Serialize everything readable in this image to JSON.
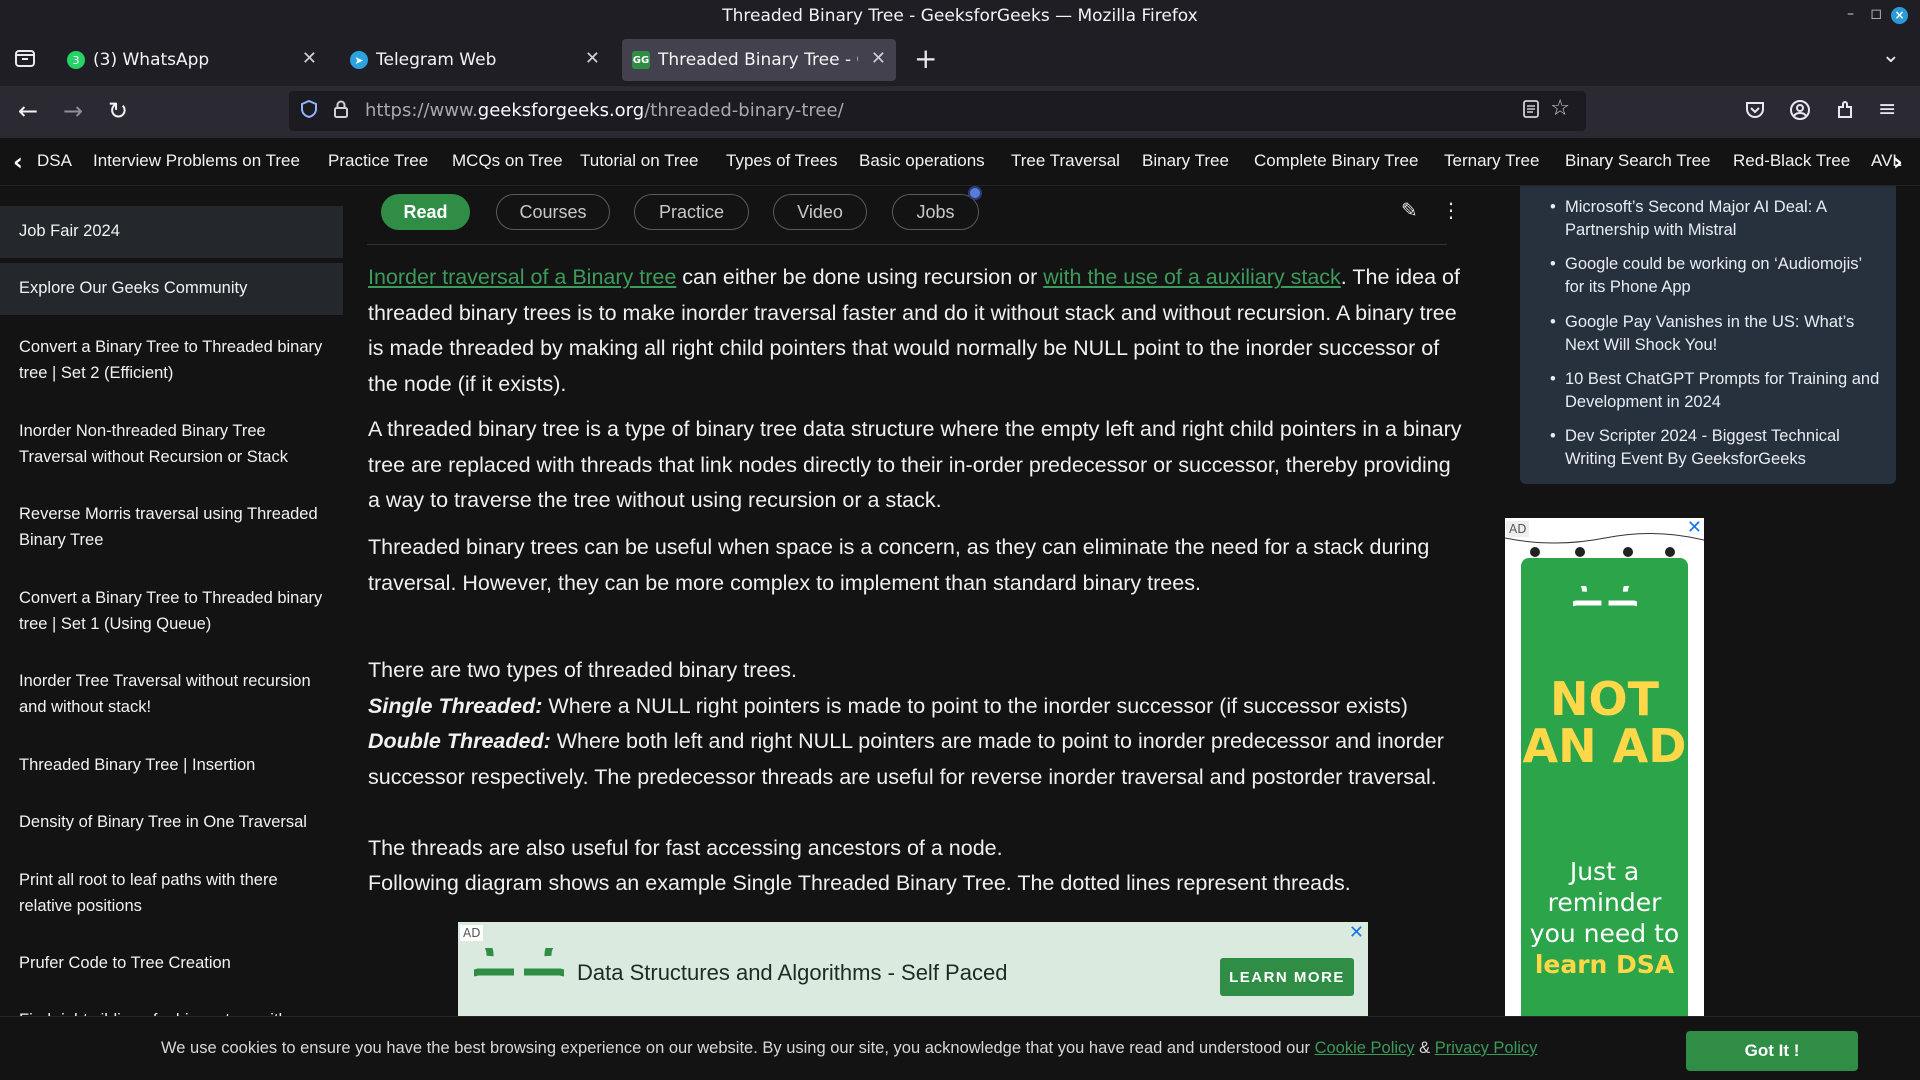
{
  "window": {
    "title": "Threaded Binary Tree - GeeksforGeeks — Mozilla Firefox",
    "minimize": "–",
    "maximize": "◻",
    "close": "×"
  },
  "tabs": [
    {
      "label": "(3) WhatsApp",
      "icon": "whatsapp-icon",
      "badge": "3",
      "active": false
    },
    {
      "label": "Telegram Web",
      "icon": "telegram-icon",
      "active": false
    },
    {
      "label": "Threaded Binary Tree - Gee",
      "icon": "gfg-icon",
      "active": true
    }
  ],
  "tab_controls": {
    "new_tab": "+",
    "list_all": "⌄",
    "close": "✕"
  },
  "navbar": {
    "back": "←",
    "forward": "→",
    "reload": "↻",
    "url_prefix": "https://www.",
    "url_host": "geeksforgeeks.org",
    "url_path": "/threaded-binary-tree/"
  },
  "bookmarks": [
    "DSA",
    "Interview Problems on Tree",
    "Practice Tree",
    "MCQs on Tree",
    "Tutorial on Tree",
    "Types of Trees",
    "Basic operations",
    "Tree Traversal",
    "Binary Tree",
    "Complete Binary Tree",
    "Ternary Tree",
    "Binary Search Tree",
    "Red-Black Tree",
    "AVL"
  ],
  "sidebar": {
    "items": [
      "Job Fair 2024",
      "Explore Our Geeks Community",
      "Convert a Binary Tree to Threaded binary tree | Set 2 (Efficient)",
      "Inorder Non-threaded Binary Tree Traversal without Recursion or Stack",
      "Reverse Morris traversal using Threaded Binary Tree",
      "Convert a Binary Tree to Threaded binary tree | Set 1 (Using Queue)",
      "Inorder Tree Traversal without recursion and without stack!",
      "Threaded Binary Tree | Insertion",
      "Density of Binary Tree in One Traversal",
      "Print all root to leaf paths with there relative positions",
      "Prufer Code to Tree Creation",
      "Find right sibling of a binary tree with parent pointers"
    ]
  },
  "article_tabs": [
    "Read",
    "Courses",
    "Practice",
    "Video",
    "Jobs"
  ],
  "article": {
    "p1_link1": "Inorder traversal of a Binary tree",
    "p1_mid": " can either be done using recursion or ",
    "p1_link2": "with the use of a auxiliary stack",
    "p1_rest": ". The idea of threaded binary trees is to make inorder traversal faster and do it without stack and without recursion. A binary tree is made threaded by making all right child pointers that would normally be NULL point to the inorder successor of the node (if it exists).",
    "p2": "A threaded binary tree is a type of binary tree data structure where the empty left and right child pointers in a binary tree are replaced with threads that link nodes directly to their in-order predecessor or successor, thereby providing a way to traverse the tree without using recursion or a stack.",
    "p3": "Threaded binary trees can be useful when space is a concern, as they can eliminate the need for a stack during traversal. However, they can be more complex to implement than standard binary trees.",
    "types_intro": "There are two types of threaded binary trees.",
    "single_label": "Single Threaded:",
    "single_text": " Where a NULL right pointers is made to point to the inorder successor (if successor exists)",
    "double_label": "Double Threaded:",
    "double_text": " Where both left and right NULL pointers are made to point to inorder predecessor and inorder successor respectively. The predecessor threads are useful for reverse inorder traversal and postorder traversal.",
    "threads_note": "The threads are also useful for fast accessing ancestors of a node.",
    "diagram_note": "Following diagram shows an example Single Threaded Binary Tree. The dotted lines represent threads."
  },
  "ad_banner": {
    "tag": "AD",
    "title": "Data Structures and Algorithms - Self Paced",
    "button": "LEARN MORE",
    "close": "✕"
  },
  "news": [
    "Microsoft’s Second Major AI Deal: A Partnership with Mistral",
    "Google could be working on ‘Audiomojis’ for its Phone App",
    "Google Pay Vanishes in the US: What’s Next Will Shock You!",
    "10 Best ChatGPT Prompts for Training and Development in 2024",
    "Dev Scripter 2024 - Biggest Technical Writing Event By GeeksforGeeks"
  ],
  "side_ad": {
    "tag": "AD",
    "close": "✕",
    "line1": "NOT",
    "line2": "AN AD",
    "reminder1": "Just a",
    "reminder2": "reminder",
    "reminder3": "you need to",
    "reminder4": "learn DSA"
  },
  "cookie": {
    "text": "We use cookies to ensure you have the best browsing experience on our website. By using our site, you acknowledge that you have read and understood our ",
    "cookie_policy": "Cookie Policy",
    "amp": " & ",
    "privacy_policy": "Privacy Policy",
    "button": "Got It !"
  },
  "colors": {
    "accent": "#2f8d46",
    "link": "#3c9a5a",
    "news_bg": "#27313e"
  }
}
